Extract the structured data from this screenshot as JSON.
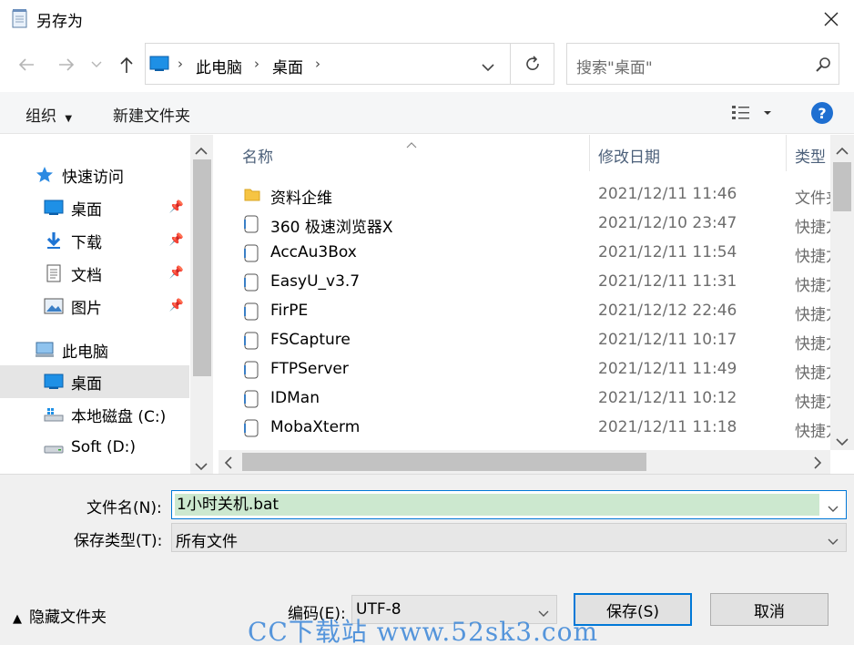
{
  "window": {
    "title": "另存为"
  },
  "address": {
    "crumbs": [
      "此电脑",
      "桌面"
    ],
    "search_placeholder": "搜索\"桌面\""
  },
  "toolbar": {
    "organize": "组织",
    "new_folder": "新建文件夹",
    "help": "?"
  },
  "sidebar": {
    "quick_access": "快速访问",
    "items": [
      {
        "label": "桌面",
        "pinned": true
      },
      {
        "label": "下载",
        "pinned": true
      },
      {
        "label": "文档",
        "pinned": true
      },
      {
        "label": "图片",
        "pinned": true
      }
    ],
    "this_pc": "此电脑",
    "pc_items": [
      {
        "label": "桌面",
        "selected": true
      },
      {
        "label": "本地磁盘 (C:)"
      },
      {
        "label": "Soft (D:)"
      }
    ]
  },
  "file_list": {
    "columns": [
      "名称",
      "修改日期",
      "类型"
    ],
    "rows": [
      {
        "name": "资料企维",
        "date": "2021/12/11 11:46",
        "type": "文件夹",
        "icon": "folder-icon"
      },
      {
        "name": "360 极速浏览器X",
        "date": "2021/12/10 23:47",
        "type": "快捷方式",
        "icon": "shortcut-icon"
      },
      {
        "name": "AccAu3Box",
        "date": "2021/12/11 11:54",
        "type": "快捷方式",
        "icon": "shortcut-icon"
      },
      {
        "name": "EasyU_v3.7",
        "date": "2021/12/11 11:31",
        "type": "快捷方式",
        "icon": "shortcut-icon"
      },
      {
        "name": "FirPE",
        "date": "2021/12/12 22:46",
        "type": "快捷方式",
        "icon": "shortcut-icon"
      },
      {
        "name": "FSCapture",
        "date": "2021/12/11 10:17",
        "type": "快捷方式",
        "icon": "shortcut-icon"
      },
      {
        "name": "FTPServer",
        "date": "2021/12/11 11:49",
        "type": "快捷方式",
        "icon": "shortcut-icon"
      },
      {
        "name": "IDMan",
        "date": "2021/12/11 10:12",
        "type": "快捷方式",
        "icon": "shortcut-icon"
      },
      {
        "name": "MobaXterm",
        "date": "2021/12/11 11:18",
        "type": "快捷方式",
        "icon": "shortcut-icon"
      }
    ]
  },
  "form": {
    "filename_label": "文件名(N):",
    "filename_value": "1小时关机.bat",
    "filetype_label": "保存类型(T):",
    "filetype_value": "所有文件",
    "encoding_label": "编码(E):",
    "encoding_value": "UTF-8",
    "hide_folders": "隐藏文件夹",
    "save": "保存(S)",
    "cancel": "取消"
  },
  "watermark": "CC下载站 www.52sk3.com",
  "colors": {
    "accent": "#0078d7",
    "selection": "#cce8cf",
    "help": "#1e6fd1"
  }
}
